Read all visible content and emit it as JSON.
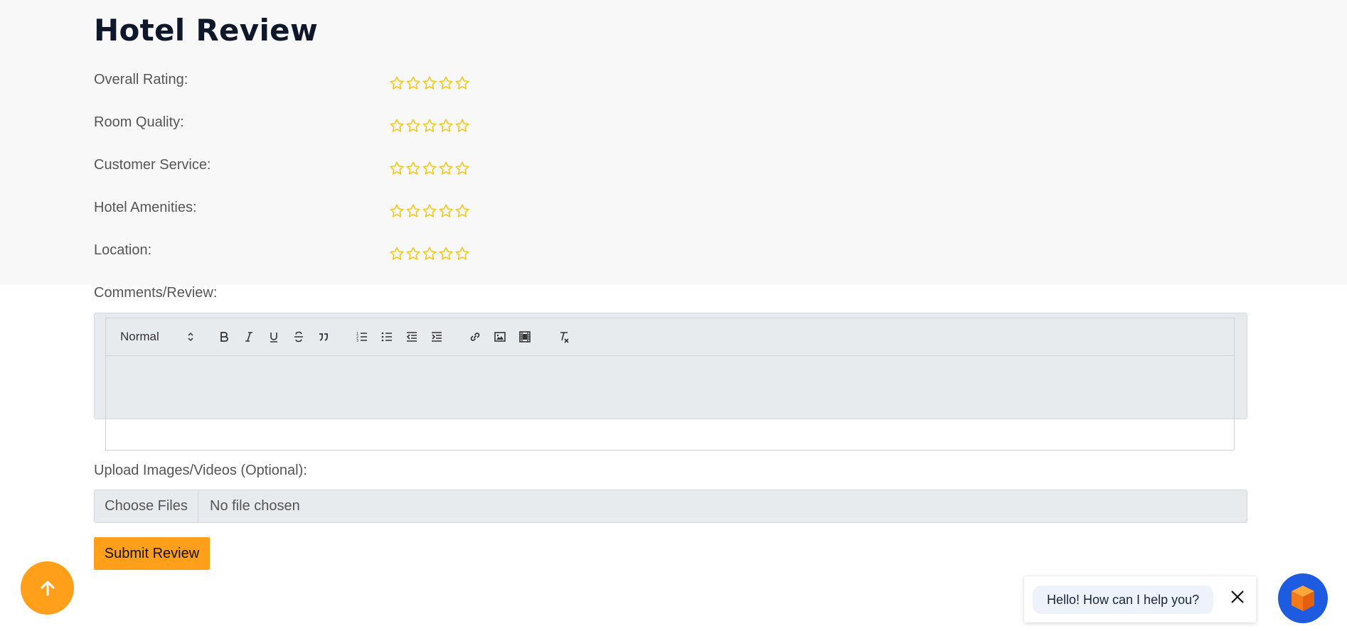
{
  "page": {
    "title": "Hotel Review"
  },
  "ratings": [
    {
      "label": "Overall Rating:",
      "value": 0,
      "max": 5
    },
    {
      "label": "Room Quality:",
      "value": 0,
      "max": 5
    },
    {
      "label": "Customer Service:",
      "value": 0,
      "max": 5
    },
    {
      "label": "Hotel Amenities:",
      "value": 0,
      "max": 5
    },
    {
      "label": "Location:",
      "value": 0,
      "max": 5
    }
  ],
  "comments": {
    "label": "Comments/Review:",
    "format_select": "Normal",
    "toolbar_icons": [
      "bold-icon",
      "italic-icon",
      "underline-icon",
      "strikethrough-icon",
      "blockquote-icon",
      "ordered-list-icon",
      "bullet-list-icon",
      "outdent-icon",
      "indent-icon",
      "link-icon",
      "image-icon",
      "video-icon",
      "clear-format-icon"
    ],
    "content": ""
  },
  "upload": {
    "label": "Upload Images/Videos (Optional):",
    "button_label": "Choose Files",
    "status": "No file chosen"
  },
  "submit": {
    "label": "Submit Review"
  },
  "chat": {
    "message": "Hello! How can I help you?"
  },
  "colors": {
    "accent": "#ff9f1a",
    "star": "#f5c518",
    "chat_launcher": "#1d5be0",
    "title": "#0f172a"
  }
}
